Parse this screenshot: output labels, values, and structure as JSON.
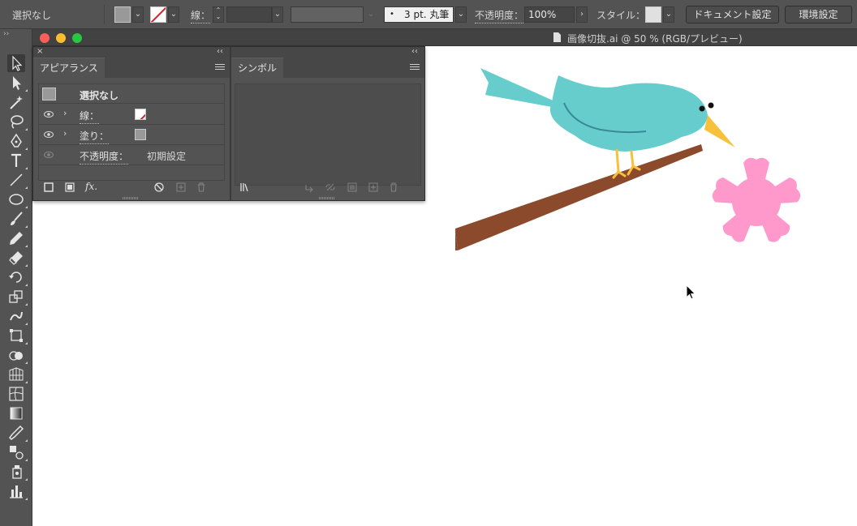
{
  "control_bar": {
    "selection_label": "選択なし",
    "stroke_label": "線：",
    "stroke_weight_value": "",
    "brush_label": "3 pt. 丸筆",
    "opacity_label": "不透明度：",
    "opacity_value": "100%",
    "style_label": "スタイル：",
    "document_setup_button": "ドキュメント設定",
    "preferences_button": "環境設定"
  },
  "document": {
    "title": "画像切抜.ai @ 50 % (RGB/プレビュー)"
  },
  "appearance_panel": {
    "tab_label": "アピアランス",
    "header_label": "選択なし",
    "rows": [
      {
        "label": "線："
      },
      {
        "label": "塗り："
      },
      {
        "label": "不透明度：",
        "value": "初期設定"
      }
    ],
    "fx_label": "fx."
  },
  "symbols_panel": {
    "tab_label": "シンボル"
  },
  "tools": [
    "selection-tool",
    "direct-selection-tool",
    "magic-wand-tool",
    "lasso-tool",
    "pen-tool",
    "type-tool",
    "line-segment-tool",
    "ellipse-tool",
    "paintbrush-tool",
    "pencil-tool",
    "eraser-tool",
    "rotate-tool",
    "scale-tool",
    "warp-tool",
    "free-transform-tool",
    "shape-builder-tool",
    "perspective-grid-tool",
    "mesh-tool",
    "gradient-tool",
    "eyedropper-tool",
    "blend-tool",
    "symbol-sprayer-tool",
    "column-graph-tool"
  ],
  "colors": {
    "bird_body": "#66cccc",
    "bird_beak": "#f7c13b",
    "branch": "#8b4a2b",
    "flower": "#ff99cc",
    "ui_dark": "#535353",
    "ui_darker": "#424242"
  }
}
